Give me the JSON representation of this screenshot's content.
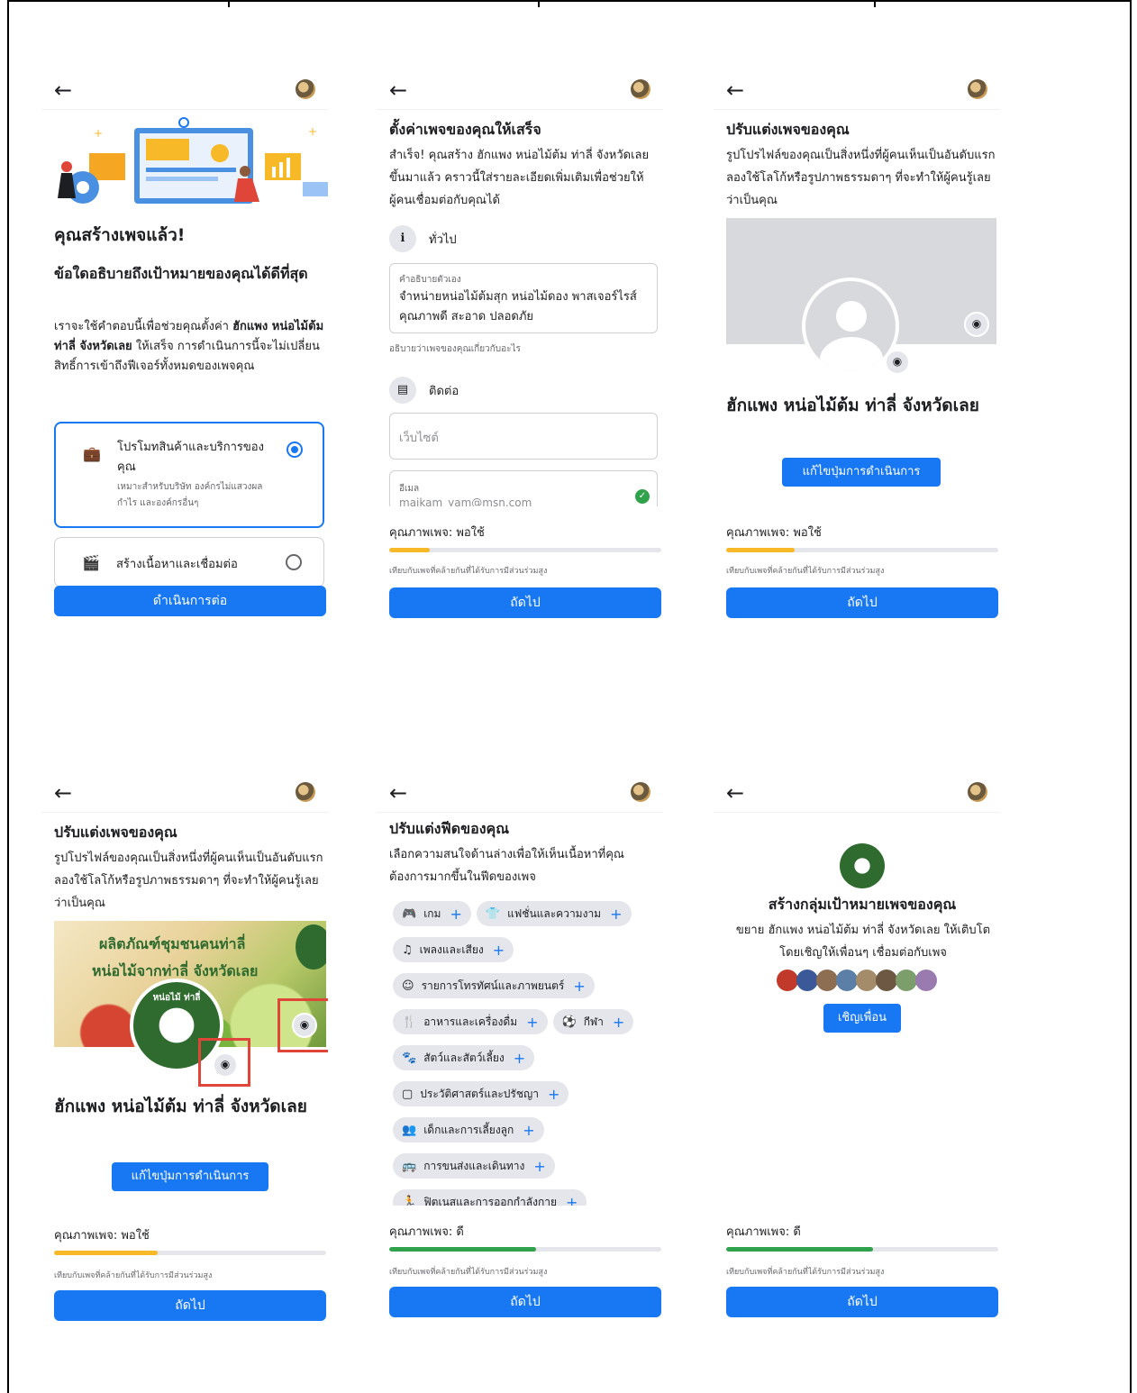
{
  "common": {
    "back_icon": "←",
    "next_label": "ถัดไป",
    "quality_note": "เทียบกับเพจที่คล้ายกันที่ได้รับการมีส่วนร่วมสูง",
    "quality_fair": "คุณภาพเพจ: พอใช้",
    "quality_good": "คุณภาพเพจ: ดี",
    "page_name": "ฮักแพง หน่อไม้ต้ม ท่าลี่ จังหวัดเลย",
    "edit_action_button": "แก้ไขปุ่มการดำเนินการ",
    "colors": {
      "primary": "#1877f2",
      "fair": "#f7b928",
      "good": "#31a24c",
      "highlight": "#e0453a"
    }
  },
  "panel1": {
    "title": "คุณสร้างเพจแล้ว!",
    "subtitle": "ข้อใดอธิบายถึงเป้าหมายของคุณได้ดีที่สุด",
    "desc_pre": "เราจะใช้คำตอบนี้เพื่อช่วยคุณตั้งค่า",
    "desc_bold": "ฮักแพง หน่อไม้ต้ม ท่าลี่ จังหวัดเลย",
    "desc_post": "ให้เสร็จ การดำเนินการนี้จะไม่เปลี่ยนสิทธิ์การเข้าถึงฟีเจอร์ทั้งหมดของเพจคุณ",
    "option1_title": "โปรโมทสินค้าและบริการของคุณ",
    "option1_desc": "เหมาะสำหรับบริษัท องค์กรไม่แสวงผลกำไร และองค์กรอื่นๆ",
    "option2_title": "สร้างเนื้อหาและเชื่อมต่อ",
    "continue_label": "ดำเนินการต่อ"
  },
  "panel2": {
    "title": "ตั้งค่าเพจของคุณให้เสร็จ",
    "desc": "สำเร็จ! คุณสร้าง ฮักแพง หน่อไม้ต้ม ท่าลี่ จังหวัดเลย ขึ้นมาแล้ว คราวนี้ใส่รายละเอียดเพิ่มเติมเพื่อช่วยให้ผู้คนเชื่อมต่อกับคุณได้",
    "section_general": "ทั่วไป",
    "bio_label": "คำอธิบายตัวเอง",
    "bio_value": "จำหน่ายหน่อไม้ต้มสุก หน่อไม้ดอง พาสเจอร์ไรส์ คุณภาพดี สะอาด ปลอดภัย",
    "bio_hint": "อธิบายว่าเพจของคุณเกี่ยวกับอะไร",
    "section_contact": "ติดต่อ",
    "website_placeholder": "เว็บไซต์",
    "email_label": "อีเมล",
    "email_value": "maikam_yam@msn.com",
    "quality_value": 0.15
  },
  "panel3": {
    "title": "ปรับแต่งเพจของคุณ",
    "desc": "รูปโปรไฟล์ของคุณเป็นสิ่งหนึ่งที่ผู้คนเห็นเป็นอันดับแรก ลองใช้โลโก้หรือรูปภาพธรรมดาๆ ที่จะทำให้ผู้คนรู้เลยว่าเป็นคุณ",
    "quality_value": 0.25
  },
  "panel4": {
    "title": "ปรับแต่งเพจของคุณ",
    "desc": "รูปโปรไฟล์ของคุณเป็นสิ่งหนึ่งที่ผู้คนเห็นเป็นอันดับแรก ลองใช้โลโก้หรือรูปภาพธรรมดาๆ ที่จะทำให้ผู้คนรู้เลยว่าเป็นคุณ",
    "cover_line1": "ผลิตภัณฑ์ชุมชนคนท่าลี่",
    "cover_line2": "หน่อไม้จากท่าลี่ จังหวัดเลย",
    "logo_text": "หน่อไม้ ท่าลี่",
    "quality_value": 0.38
  },
  "panel5": {
    "title": "ปรับแต่งฟีดของคุณ",
    "desc": "เลือกความสนใจด้านล่างเพื่อให้เห็นเนื้อหาที่คุณต้องการมากขึ้นในฟีดของเพจ",
    "chips": [
      {
        "icon": "🎮",
        "label": "เกม"
      },
      {
        "icon": "👕",
        "label": "แฟชั่นและความงาม"
      },
      {
        "icon": "♫",
        "label": "เพลงและเสียง"
      },
      {
        "icon": "☺",
        "label": "รายการโทรทัศน์และภาพยนตร์"
      },
      {
        "icon": "🍴",
        "label": "อาหารและเครื่องดื่ม"
      },
      {
        "icon": "⚽",
        "label": "กีฬา"
      },
      {
        "icon": "🐾",
        "label": "สัตว์และสัตว์เลี้ยง"
      },
      {
        "icon": "▢",
        "label": "ประวัติศาสตร์และปรัชญา"
      },
      {
        "icon": "👥",
        "label": "เด็กและการเลี้ยงลูก"
      },
      {
        "icon": "🚌",
        "label": "การขนส่งและเดินทาง"
      },
      {
        "icon": "🏃",
        "label": "ฟิตเนสและการออกกำลังกาย"
      }
    ],
    "quality_value": 0.54
  },
  "panel6": {
    "title": "สร้างกลุ่มเป้าหมายเพจของคุณ",
    "desc": "ขยาย ฮักแพง หน่อไม้ต้ม ท่าลี่ จังหวัดเลย ให้เติบโตโดยเชิญให้เพื่อนๆ เชื่อมต่อกับเพจ",
    "invite_label": "เชิญเพื่อน",
    "quality_value": 0.54
  }
}
